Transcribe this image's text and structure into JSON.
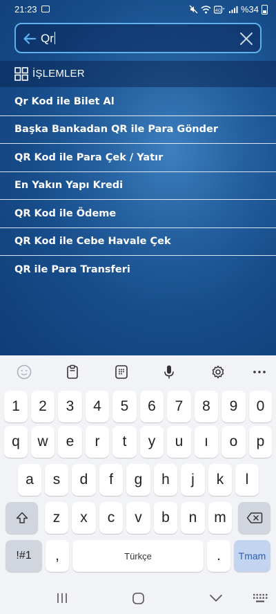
{
  "status_bar": {
    "time": "21:23",
    "battery_text": "%34"
  },
  "search": {
    "value": "Qr",
    "placeholder": ""
  },
  "section": {
    "title": "İŞLEMLER",
    "icon": "grid-icon"
  },
  "results": [
    {
      "label": "Qr Kod ile Bilet Al"
    },
    {
      "label": "Başka Bankadan QR ile Para Gönder"
    },
    {
      "label": "QR Kod ile Para Çek / Yatır"
    },
    {
      "label": "En Yakın Yapı Kredi"
    },
    {
      "label": "QR Kod ile Ödeme"
    },
    {
      "label": "QR Kod ile Cebe Havale Çek"
    },
    {
      "label": "QR ile Para Transferi"
    }
  ],
  "keyboard": {
    "toolbar_icons": [
      "emoji-icon",
      "clipboard-icon",
      "keypad-icon",
      "microphone-icon",
      "settings-icon",
      "more-icon"
    ],
    "number_row": [
      "1",
      "2",
      "3",
      "4",
      "5",
      "6",
      "7",
      "8",
      "9",
      "0"
    ],
    "row1": [
      "q",
      "w",
      "e",
      "r",
      "t",
      "y",
      "u",
      "ı",
      "o",
      "p"
    ],
    "row2": [
      "a",
      "s",
      "d",
      "f",
      "g",
      "h",
      "j",
      "k",
      "l"
    ],
    "row3": [
      "z",
      "x",
      "c",
      "v",
      "b",
      "n",
      "m"
    ],
    "symbols_label": "!#1",
    "comma_label": ",",
    "space_label": "Türkçe",
    "period_label": ".",
    "action_label": "Tmam"
  },
  "colors": {
    "accent": "#5fb2ee",
    "app_background": "#174c8a",
    "keyboard_background": "#f2f3f7",
    "action_key": "#c2d4ef"
  }
}
